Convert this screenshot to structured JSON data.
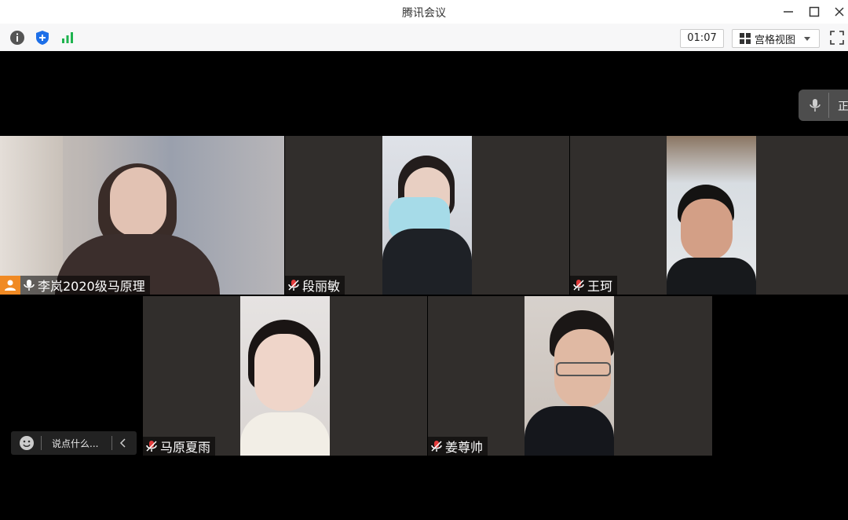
{
  "window": {
    "title": "腾讯会议"
  },
  "toolbar": {
    "timer": "01:07",
    "view_label": "宫格视图"
  },
  "floating_bar": {
    "text": "正"
  },
  "participants": [
    {
      "name": "李岚2020级马原理",
      "host": true,
      "muted": false
    },
    {
      "name": "段丽敏",
      "muted": true
    },
    {
      "name": "王珂",
      "muted": true
    },
    {
      "name": "马原夏雨",
      "muted": true
    },
    {
      "name": "姜尊帅",
      "muted": true
    }
  ],
  "chat": {
    "placeholder": "说点什么..."
  },
  "colors": {
    "tile_bg": "#312e2c",
    "host_badge": "#f08a24",
    "muted_mic": "#e33b3b",
    "toolbar_green": "#1fb34f",
    "shield_blue": "#1d6fe8"
  }
}
